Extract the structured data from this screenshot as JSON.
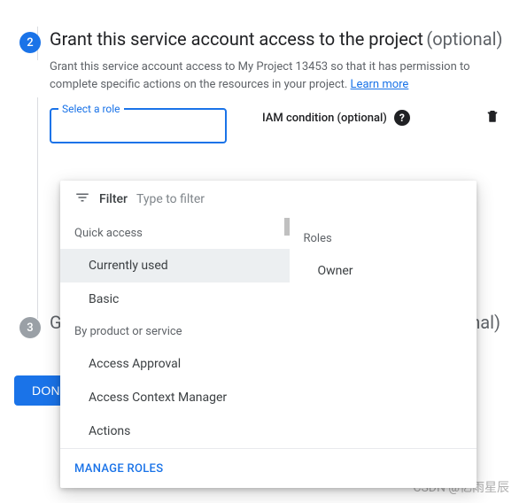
{
  "step2": {
    "number": "2",
    "title": "Grant this service account access to the project",
    "optional": "(optional)",
    "description_prefix": "Grant this service account access to My Project 13453 so that it has permission to complete specific actions on the resources in your project. ",
    "learn_more": "Learn more",
    "role_field_label": "Select a role",
    "iam_condition_label": "IAM condition (optional)"
  },
  "dropdown": {
    "filter_label": "Filter",
    "filter_placeholder": "Type to filter",
    "left": {
      "quick_access_heading": "Quick access",
      "items_quick": [
        {
          "label": "Currently used",
          "selected": true
        },
        {
          "label": "Basic",
          "selected": false
        }
      ],
      "by_product_heading": "By product or service",
      "items_product": [
        {
          "label": "Access Approval"
        },
        {
          "label": "Access Context Manager"
        },
        {
          "label": "Actions"
        }
      ]
    },
    "right": {
      "heading": "Roles",
      "items": [
        {
          "label": "Owner"
        }
      ]
    },
    "footer": "MANAGE ROLES"
  },
  "step3": {
    "number": "3",
    "title_visible": "G",
    "optional_visible": "ptional)"
  },
  "done_button": "DONE",
  "watermark": "CSDN @忆雨星辰"
}
